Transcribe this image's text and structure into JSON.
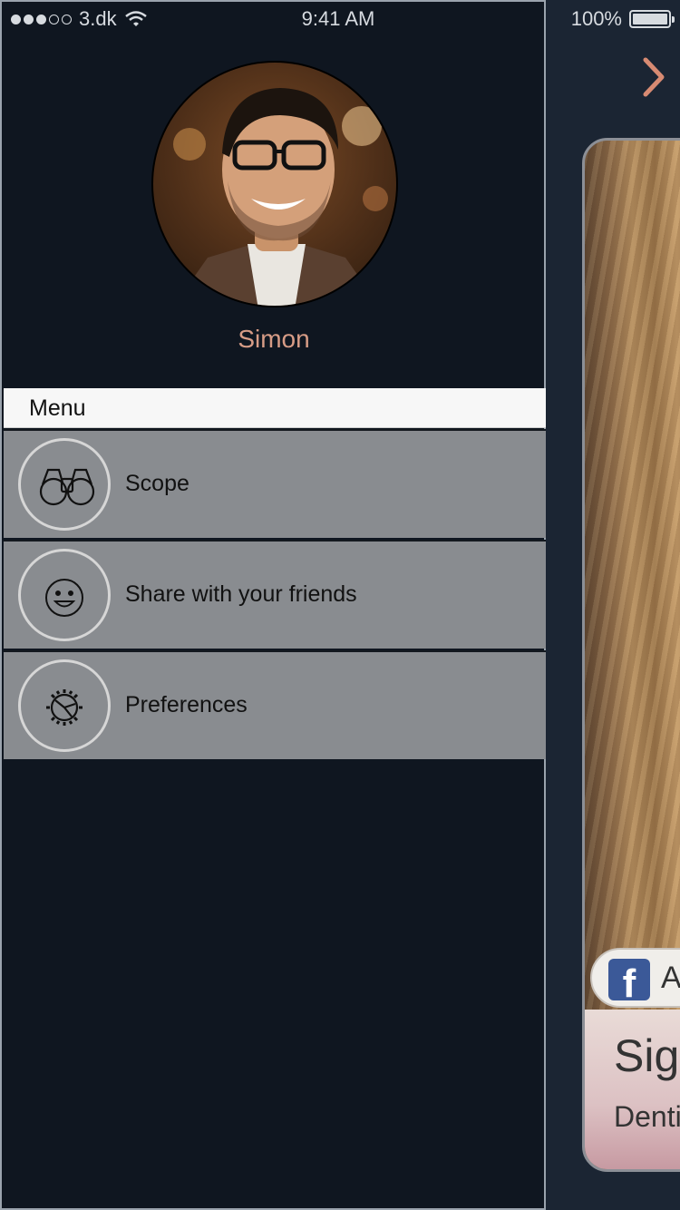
{
  "status_bar": {
    "carrier": "3.dk",
    "time": "9:41 AM",
    "battery": "100%",
    "signal_dots_filled": 3,
    "signal_dots_total": 5
  },
  "profile": {
    "name": "Simon"
  },
  "menu": {
    "header": "Menu",
    "items": [
      {
        "label": "Scope",
        "icon": "binoculars-icon"
      },
      {
        "label": "Share with your friends",
        "icon": "smiley-icon"
      },
      {
        "label": "Preferences",
        "icon": "gear-icon"
      }
    ]
  },
  "main": {
    "facebook_button_text": "At",
    "card_title": "Sigr",
    "card_subtitle": "Denti"
  },
  "colors": {
    "accent": "#d79c86",
    "drawer_bg": "#0f1620",
    "menu_item_bg": "#898c90",
    "facebook_blue": "#3b5998"
  }
}
